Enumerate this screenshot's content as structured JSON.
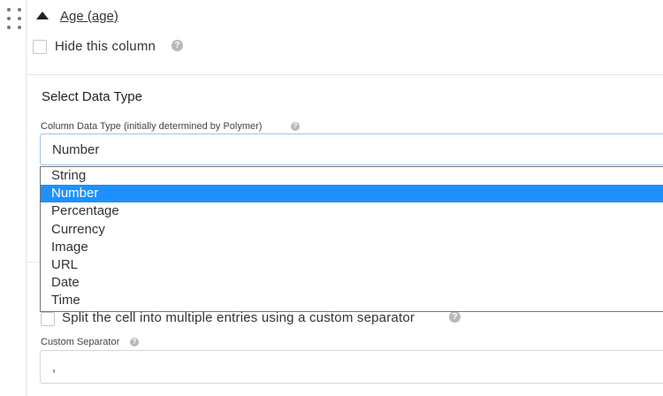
{
  "column": {
    "title": "Age (age)"
  },
  "hide_column": {
    "label": "Hide this column",
    "checked": false
  },
  "data_type": {
    "section_title": "Select Data Type",
    "field_label": "Column Data Type (initially determined by Polymer)",
    "selected": "Number",
    "options": [
      "String",
      "Number",
      "Percentage",
      "Currency",
      "Image",
      "URL",
      "Date",
      "Time"
    ]
  },
  "split": {
    "label": "Split the cell into multiple entries using a custom separator",
    "checked": false
  },
  "separator": {
    "field_label": "Custom Separator",
    "value": ","
  },
  "icons": {
    "help": "question-circle-icon",
    "drag": "drag-handle-icon",
    "toggle": "caret-up-icon"
  },
  "colors": {
    "selected_option": "#1e90ff",
    "focus_border": "#9dc3ea",
    "help_icon": "#b9b9b9"
  }
}
